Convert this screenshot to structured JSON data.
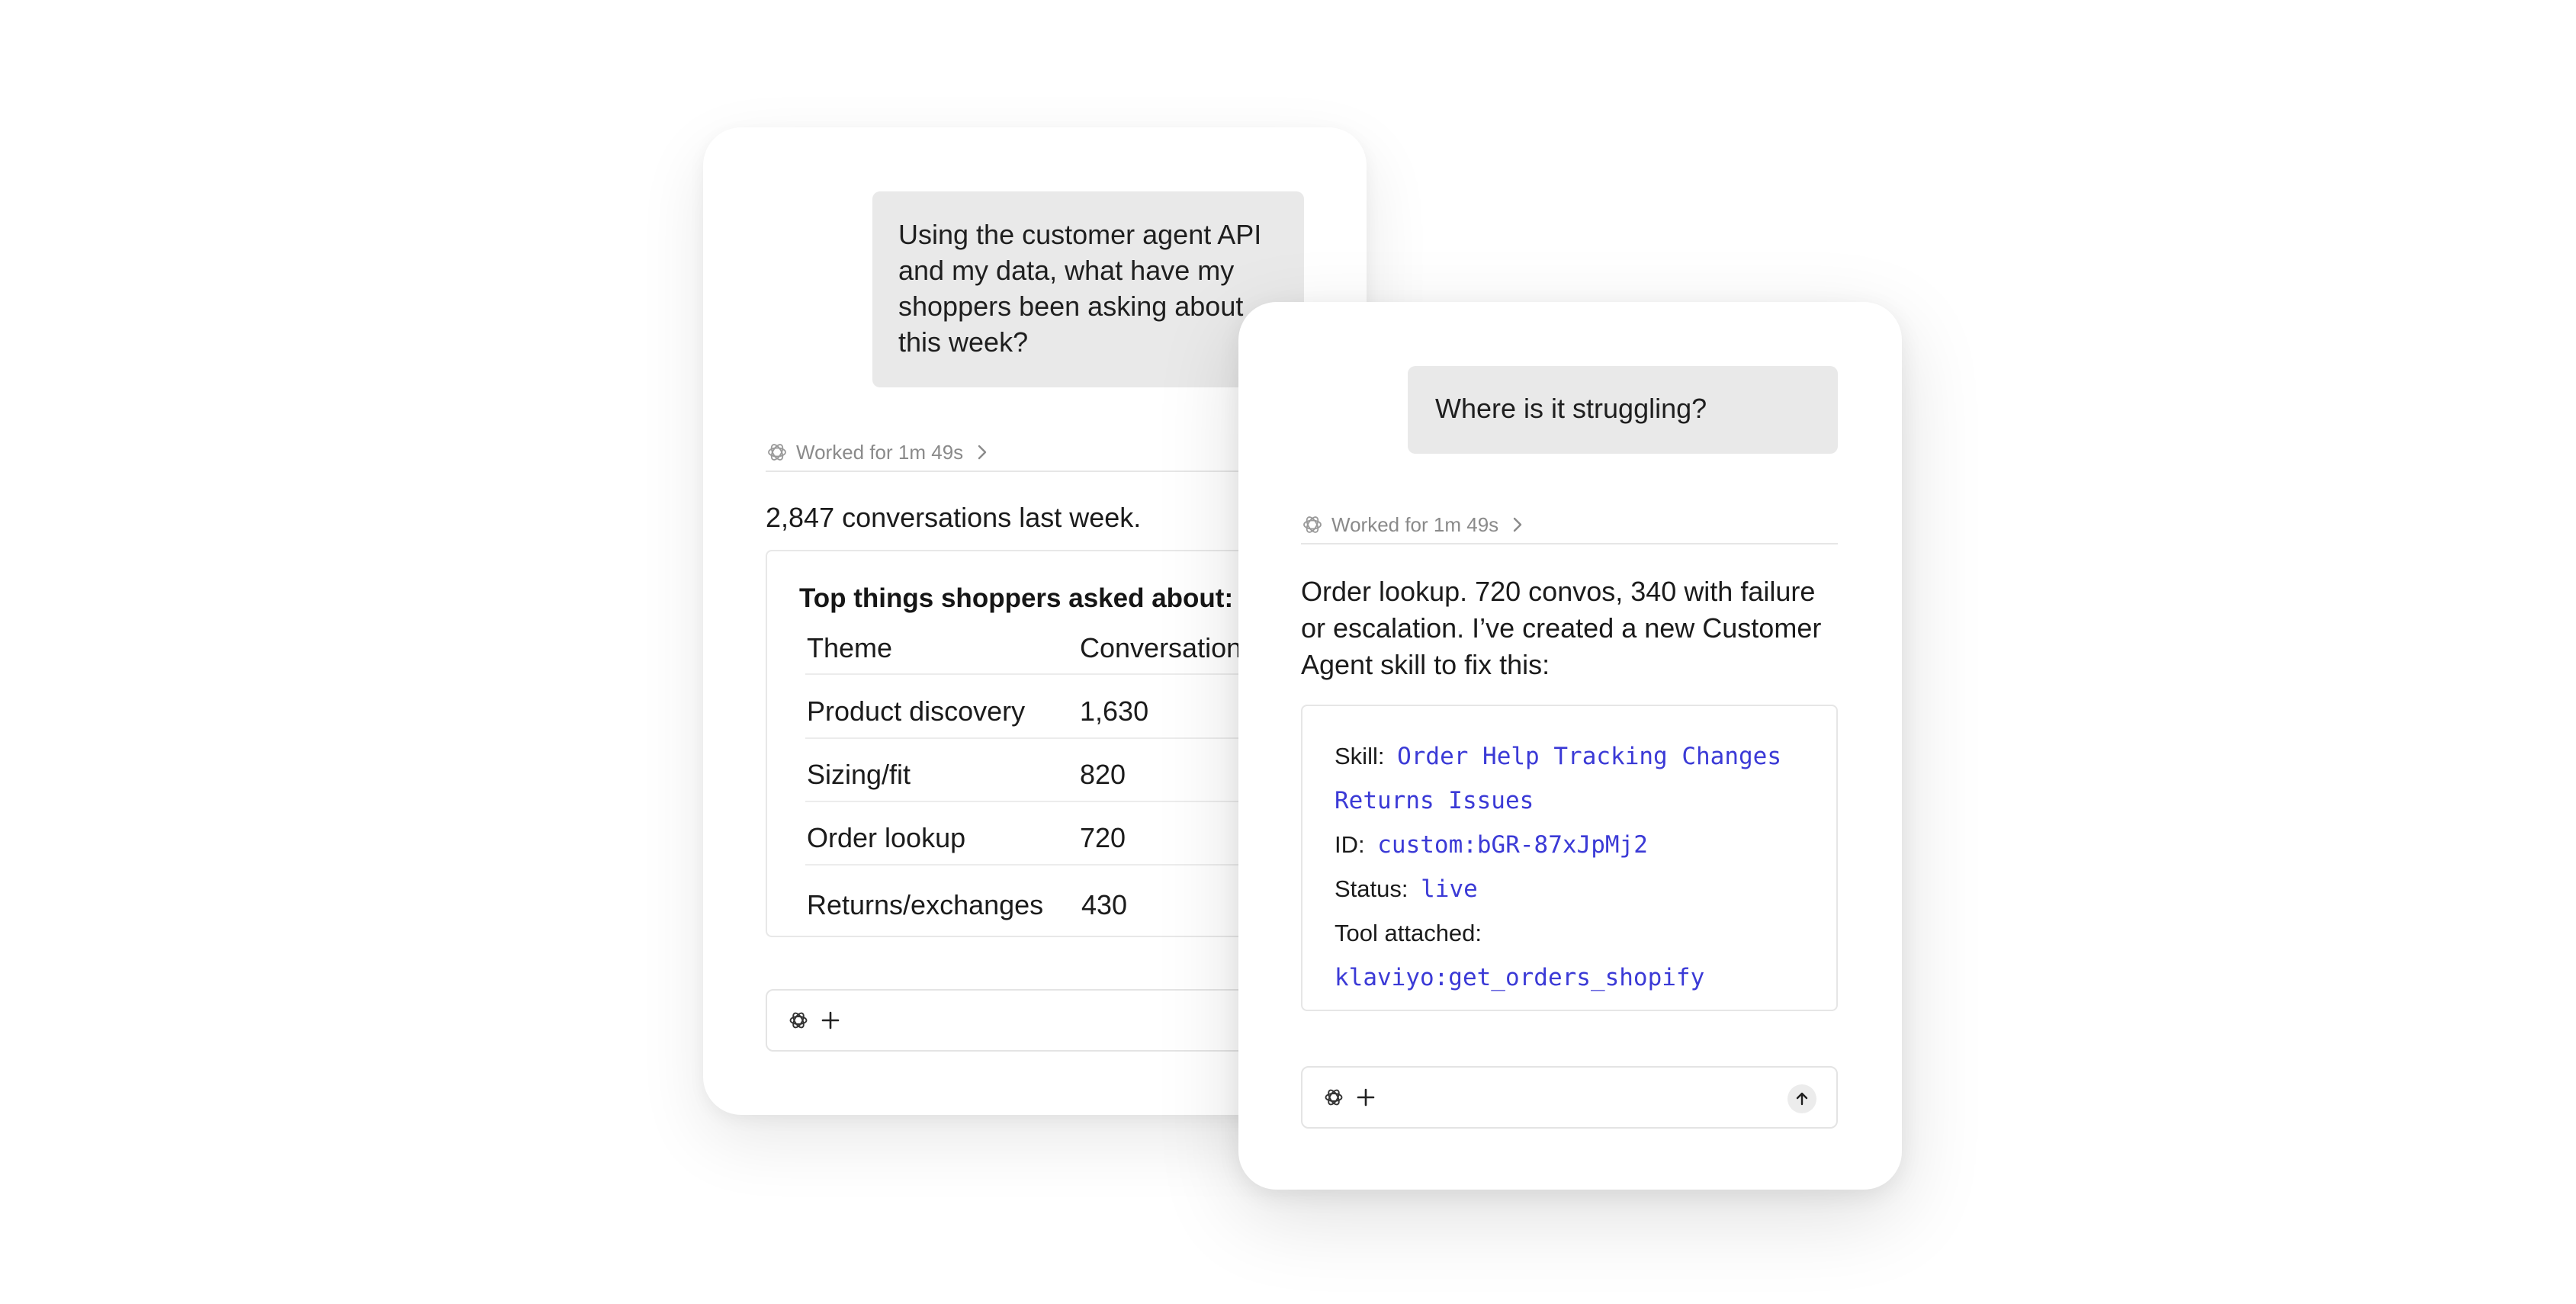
{
  "left_chat": {
    "user_message": "Using the customer agent API and my data, what have my shoppers been asking about this week?",
    "worked_label": "Worked for 1m 49s",
    "answer": "2,847 conversations last week.",
    "table": {
      "title": "Top things shoppers asked about:",
      "columns": [
        "Theme",
        "Conversations"
      ],
      "rows": [
        {
          "theme": "Product discovery",
          "count": "1,630"
        },
        {
          "theme": "Sizing/fit",
          "count": "820"
        },
        {
          "theme": "Order lookup",
          "count": "720"
        },
        {
          "theme": "Returns/exchanges",
          "count": "430"
        }
      ]
    }
  },
  "right_chat": {
    "user_message": "Where is it struggling?",
    "worked_label": "Worked for 1m 49s",
    "answer": "Order lookup. 720 convos, 340 with failure or escalation. I’ve created a new Customer Agent skill to fix this:",
    "skill": {
      "skill_label": "Skill:",
      "skill_value_line1": "Order Help Tracking Changes",
      "skill_value_line2": "Returns Issues",
      "id_label": "ID:",
      "id_value": "custom:bGR-87xJpMj2",
      "status_label": "Status:",
      "status_value": "live",
      "tool_label": "Tool attached:",
      "tool_value": "klaviyo:get_orders_shopify"
    }
  },
  "icons": {
    "worked": "openai-knot-icon",
    "chevron": "chevron-right-icon",
    "tools": "openai-knot-icon",
    "plus": "plus-icon",
    "send": "arrow-up-icon"
  },
  "colors": {
    "background": "#ffffff",
    "user_bubble": "#e9e9e9",
    "muted_text": "#8a8a8a",
    "code_text": "#3b3ad6",
    "border": "#e6e6e6"
  }
}
